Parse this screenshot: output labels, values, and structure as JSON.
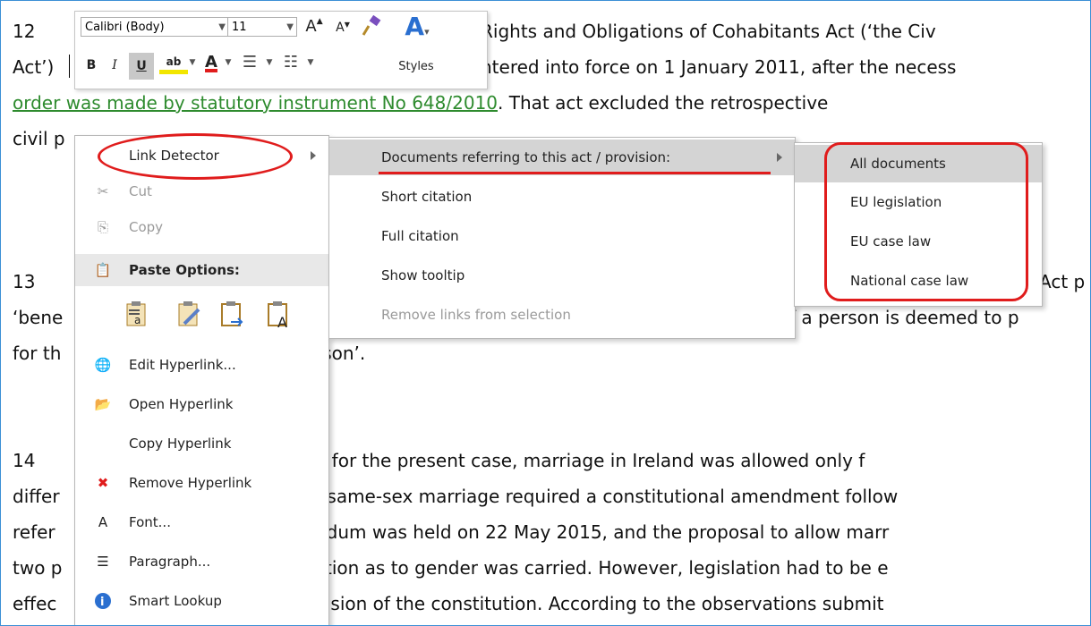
{
  "document": {
    "p12": {
      "number": "12",
      "line1": "Rights and Obligations of Cohabitants Act (‘the Civ",
      "line2_start": "Act’)",
      "line2_end": "ntered into force on 1 January 2011, after the necess",
      "link_text": "order was made by statutory instrument No 648/2010",
      "line3_end": ". That act excluded the retrospective",
      "line4": "civil p"
    },
    "p13": {
      "number": "13",
      "line1_end": "Act p",
      "line2_start": "‘bene",
      "line2_end": "f a person is deemed to p",
      "line3_start": "for th",
      "line3_end": "rson’."
    },
    "p14": {
      "number": "14",
      "line1_end": "e for the present case, marriage in Ireland was allowed only f",
      "line2_start": "differ",
      "line2_end": "f same-sex marriage required a constitutional amendment follow",
      "line3_start": "refer",
      "line3_end": "ndum was held on 22 May 2015, and the proposal to allow marr",
      "line4_start": "two p",
      "line4_end": "ction as to gender was carried. However, legislation had to be e",
      "line5_start": "effec",
      "line5_end": "vision of the constitution. According to the observations submit"
    }
  },
  "mini_toolbar": {
    "font_name": "Calibri (Body)",
    "font_size": "11",
    "grow_font": "A",
    "shrink_font": "A",
    "bold": "B",
    "italic": "I",
    "underline": "U",
    "highlight": "ab",
    "font_color": "A",
    "styles_glyph": "A",
    "styles_label": "Styles"
  },
  "context_menu": {
    "link_detector": "Link Detector",
    "cut": "Cut",
    "copy": "Copy",
    "paste_options": "Paste Options:",
    "edit_hyperlink": "Edit Hyperlink...",
    "open_hyperlink": "Open Hyperlink",
    "copy_hyperlink": "Copy Hyperlink",
    "remove_hyperlink": "Remove Hyperlink",
    "font": "Font...",
    "paragraph": "Paragraph...",
    "smart_lookup": "Smart Lookup"
  },
  "link_detector_menu": {
    "documents_referring": "Documents referring to this act / provision:",
    "short_citation": "Short citation",
    "full_citation": "Full citation",
    "show_tooltip": "Show tooltip",
    "remove_links": "Remove links from selection"
  },
  "documents_menu": {
    "all_documents": "All documents",
    "eu_legislation": "EU legislation",
    "eu_case_law": "EU case law",
    "national_case_law": "National case law"
  },
  "colors": {
    "annotation": "#e01c1c",
    "hyperlink": "#2e8b2e",
    "highlight": "#d4d4d4"
  }
}
